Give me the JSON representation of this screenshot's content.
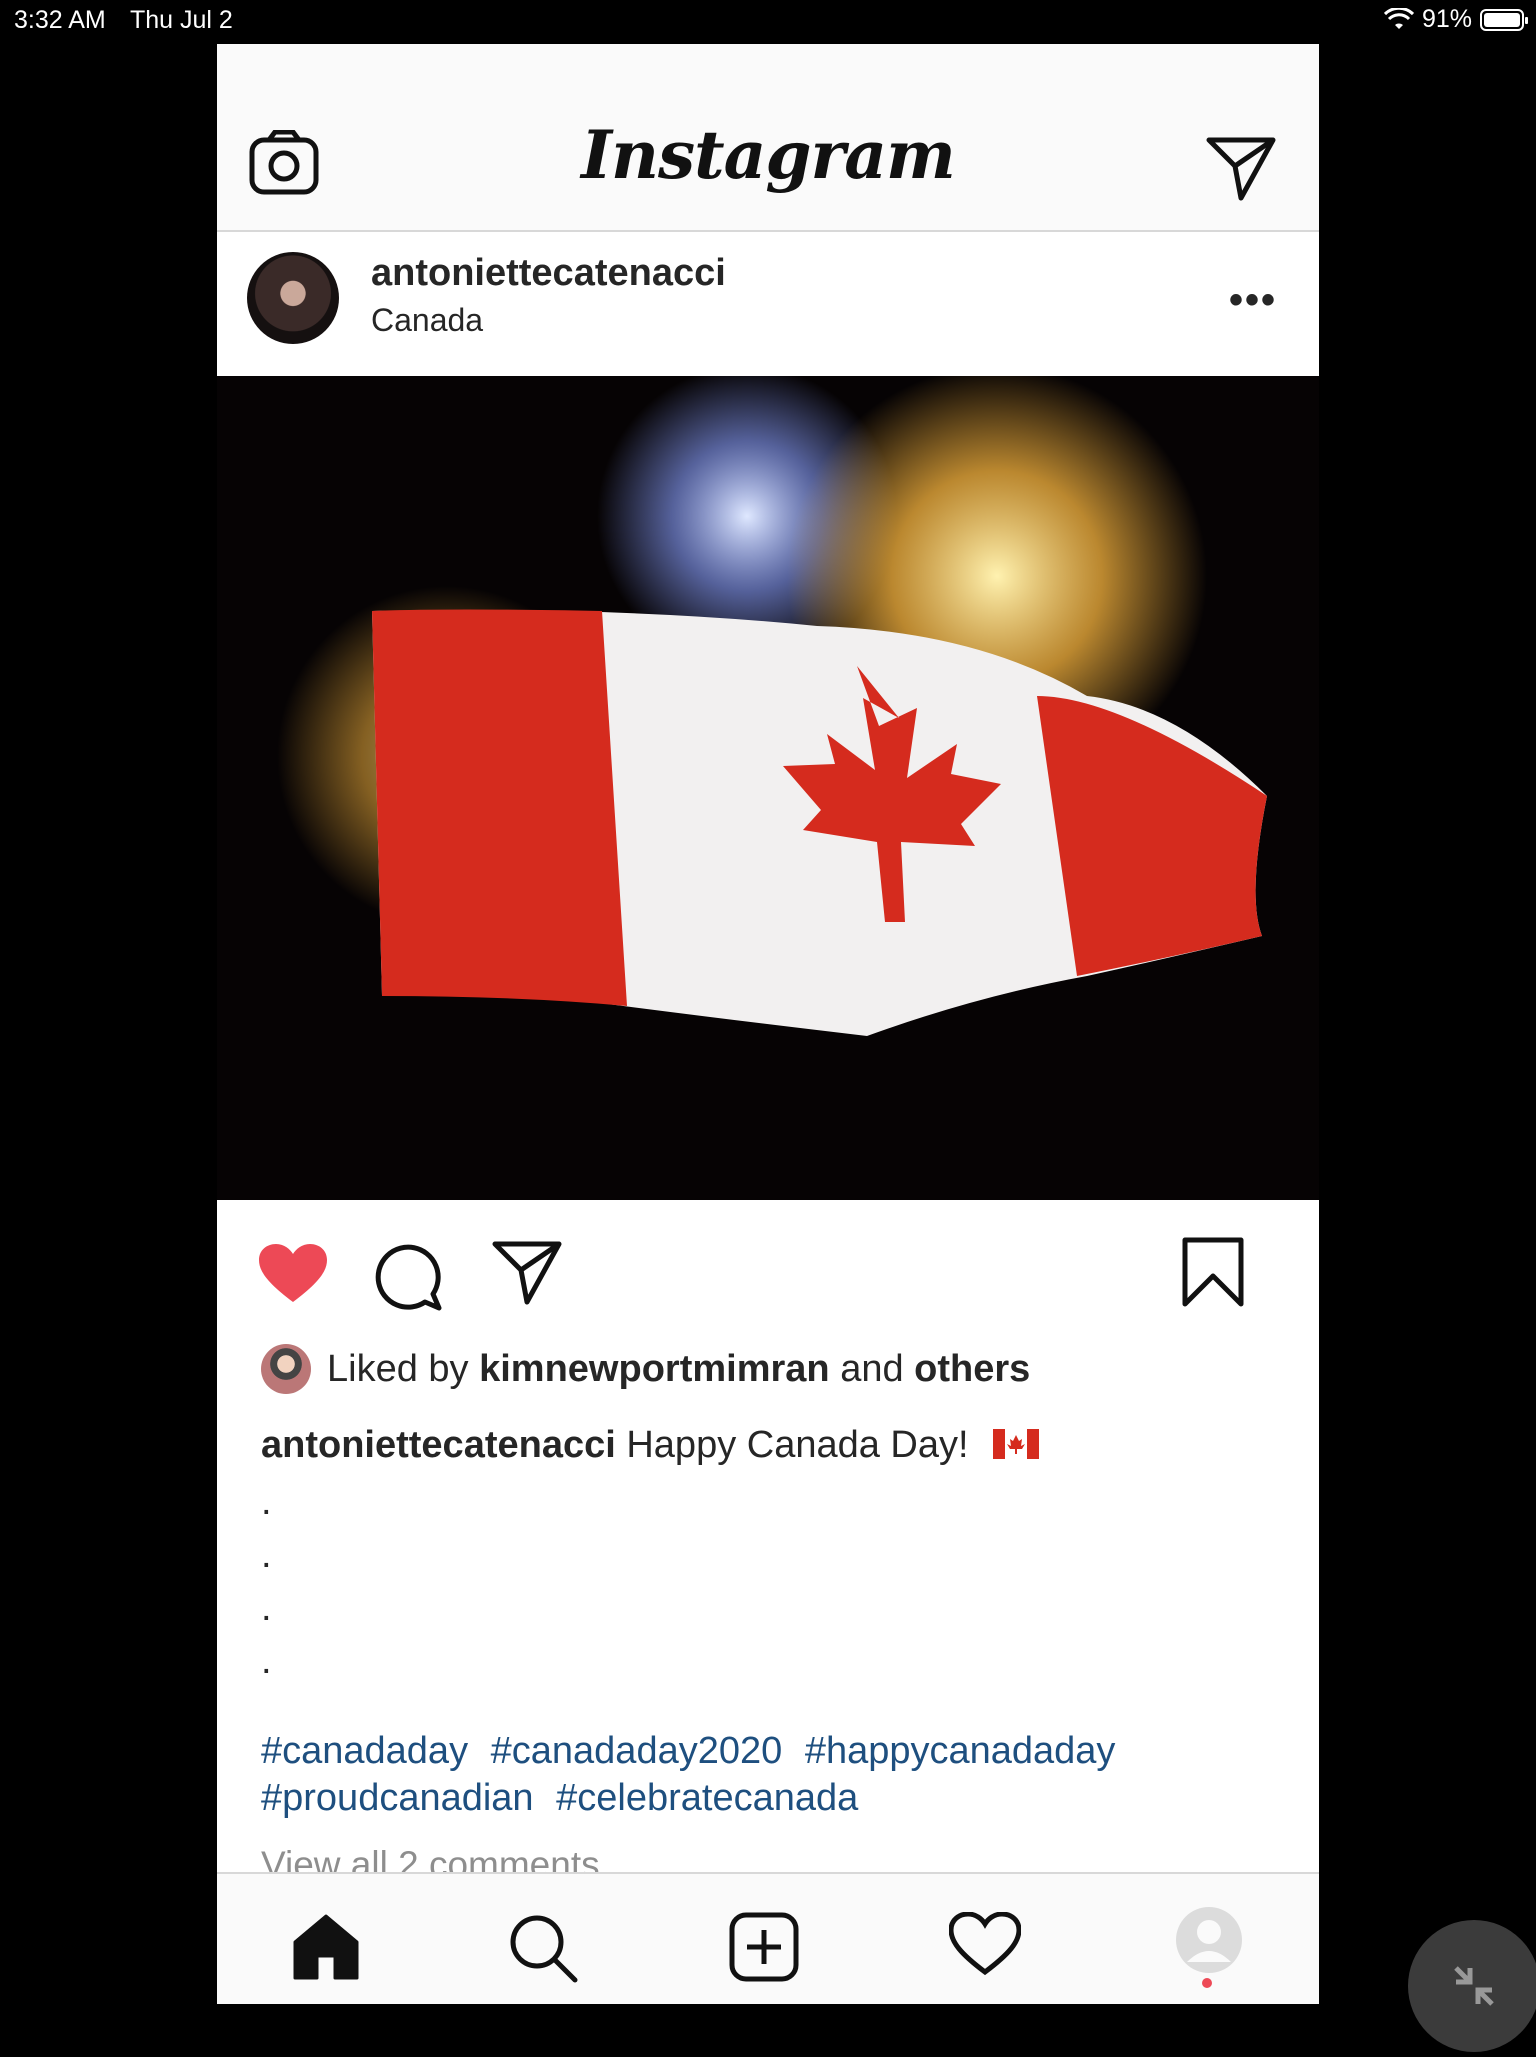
{
  "status_bar": {
    "time": "3:32 AM",
    "date": "Thu Jul 2",
    "battery": "91%"
  },
  "app": {
    "title": "Instagram"
  },
  "post": {
    "username": "antoniettecatenacci",
    "location": "Canada",
    "more_label": "•••",
    "likes": {
      "prefix": "Liked by",
      "user": "kimnewportmimran",
      "middle": "and",
      "others": "others"
    },
    "caption": {
      "user": "antoniettecatenacci",
      "text": "Happy Canada Day!"
    },
    "dots": [
      ".",
      ".",
      ".",
      "."
    ],
    "hashtags": [
      "#canadaday",
      "#canadaday2020",
      "#happycanadaday",
      "#proudcanadian",
      "#celebratecanada"
    ],
    "view_comments": "View all 2 comments",
    "liked": true
  },
  "colors": {
    "like_red": "#ed4956",
    "hashtag_blue": "#1e4f7f",
    "flag_red": "#d52b1e"
  },
  "icons": {
    "top": [
      "camera-icon",
      "direct-message-icon"
    ],
    "actions": [
      "heart-icon",
      "comment-icon",
      "share-icon",
      "bookmark-icon"
    ],
    "tabs": [
      "home-icon",
      "search-icon",
      "add-post-icon",
      "activity-heart-icon",
      "profile-icon"
    ]
  }
}
